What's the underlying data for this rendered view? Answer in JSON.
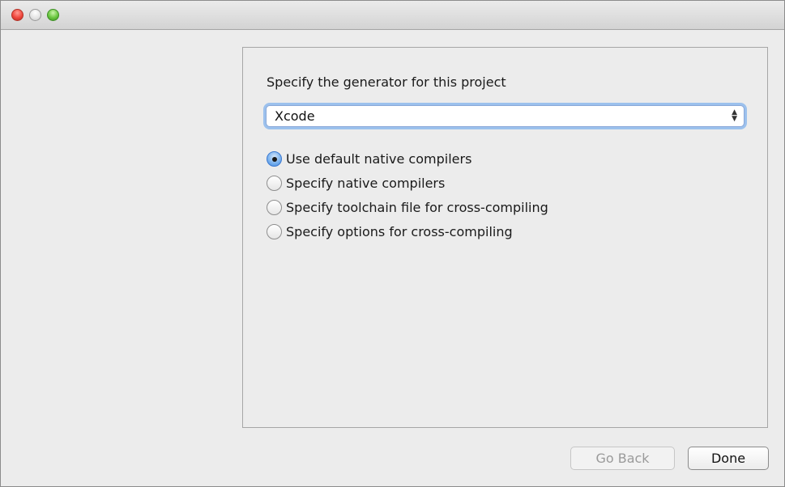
{
  "window": {
    "controls": {
      "close": "close-icon",
      "minimize": "minimize-icon",
      "zoom": "zoom-icon"
    }
  },
  "panel": {
    "generator_label": "Specify the generator for this project",
    "generator_select": {
      "value": "Xcode",
      "arrows_icon": "up-down-arrows-icon"
    },
    "options": [
      {
        "label": "Use default native compilers",
        "selected": true
      },
      {
        "label": "Specify native compilers",
        "selected": false
      },
      {
        "label": "Specify toolchain file for cross-compiling",
        "selected": false
      },
      {
        "label": "Specify options for cross-compiling",
        "selected": false
      }
    ]
  },
  "footer": {
    "back_label": "Go Back",
    "done_label": "Done"
  },
  "colors": {
    "accent": "#3e86d9",
    "focus_ring": "#9cc1ed"
  }
}
